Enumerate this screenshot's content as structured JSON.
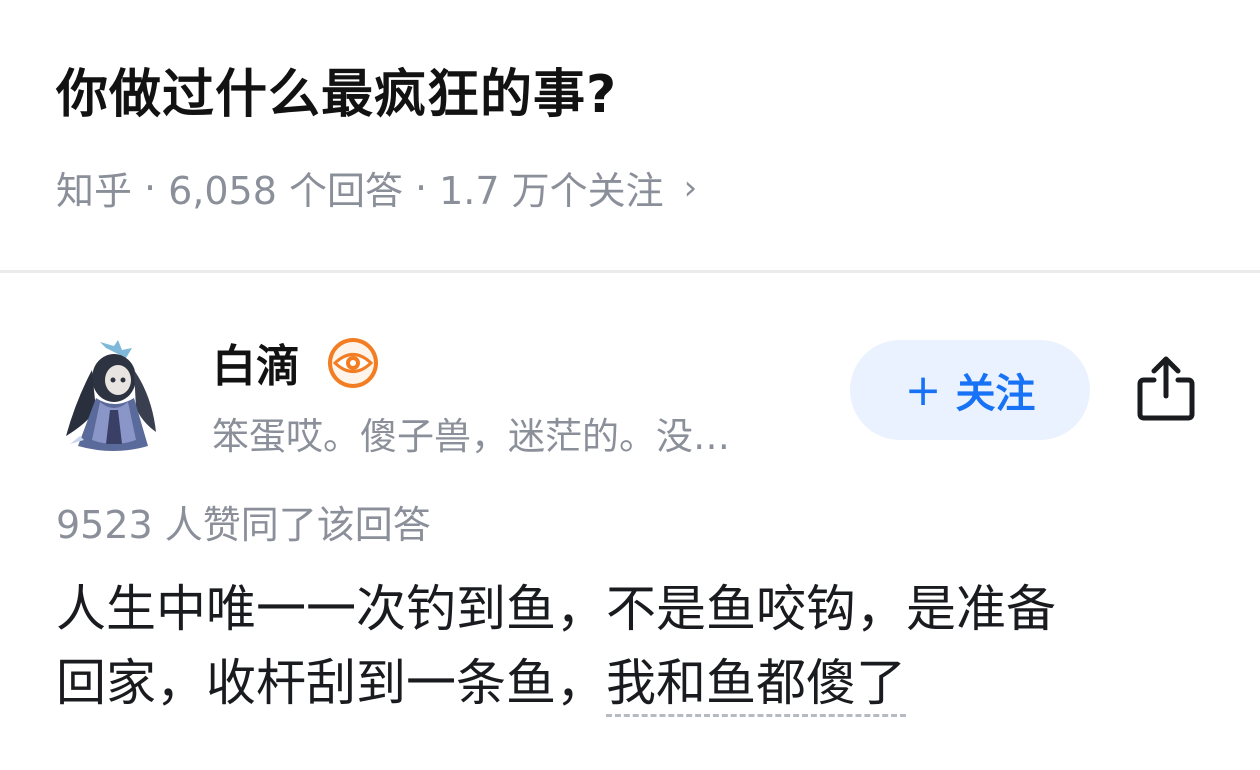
{
  "question": {
    "title": "你做过什么最疯狂的事?",
    "source": "知乎",
    "separator": "·",
    "answer_count": "6,058 个回答",
    "follower_count": "1.7 万个关注",
    "more_glyph": "›"
  },
  "author": {
    "name": "白滴",
    "badge_icon": "eye-badge-icon",
    "badge_color": "#f27d22",
    "bio": "笨蛋哎。傻子兽，迷茫的。没…"
  },
  "actions": {
    "follow_plus": "+",
    "follow_label": "关注",
    "follow_bg": "#eaf2ff",
    "follow_color": "#1772f6",
    "share_icon": "share-icon"
  },
  "answer": {
    "upvotes": "9523 人赞同了该回答",
    "line1": "人生中唯一一次钓到鱼，不是鱼咬钩，是准备",
    "line2_plain": "回家，收杆刮到一条鱼，",
    "line2_linked": "我和鱼都傻了"
  }
}
